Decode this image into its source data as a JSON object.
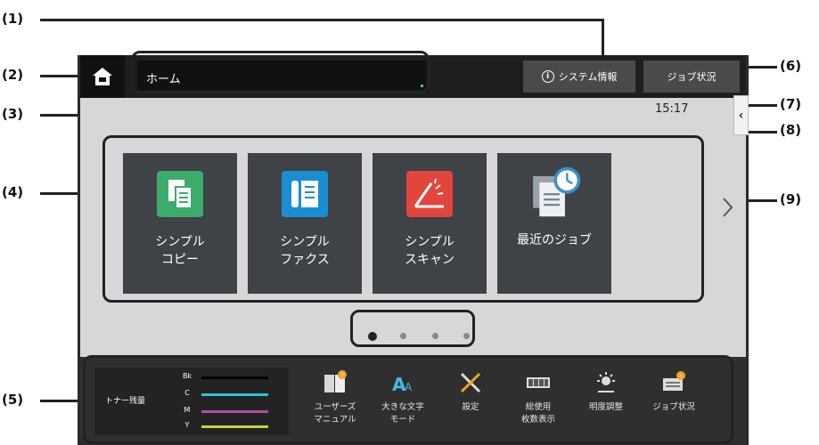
{
  "callouts": {
    "c1": "(1)",
    "c2": "(2)",
    "c3": "(3)",
    "c4": "(4)",
    "c5": "(5)",
    "c6": "(6)",
    "c7": "(7)",
    "c8": "(8)",
    "c9": "(9)"
  },
  "header": {
    "title": "ホーム",
    "system_info_label": "システム情報",
    "job_status_label": "ジョブ状況"
  },
  "clock": "15:17",
  "tiles": [
    {
      "line1": "シンプル",
      "line2": "コピー",
      "icon": "copy-icon",
      "color": "#3dab6e"
    },
    {
      "line1": "シンプル",
      "line2": "ファクス",
      "icon": "fax-icon",
      "color": "#1b8ed3"
    },
    {
      "line1": "シンプル",
      "line2": "スキャン",
      "icon": "scan-icon",
      "color": "#e2453c"
    },
    {
      "line1": "最近のジョブ",
      "line2": "",
      "icon": "recent-jobs-icon",
      "color": "#7fa6c9"
    }
  ],
  "page_dots": {
    "count": 4,
    "active": 1
  },
  "toner": {
    "label": "トナー残量",
    "channels": [
      {
        "name": "Bk",
        "color": "#000000"
      },
      {
        "name": "C",
        "color": "#28c6d6"
      },
      {
        "name": "M",
        "color": "#b04aa6"
      },
      {
        "name": "Y",
        "color": "#c9cf3a"
      }
    ]
  },
  "shortcuts": [
    {
      "line1": "ユーザーズ",
      "line2": "マニュアル",
      "icon": "manual-icon"
    },
    {
      "line1": "大きな文字",
      "line2": "モード",
      "icon": "large-text-icon"
    },
    {
      "line1": "設定",
      "line2": "",
      "icon": "settings-icon"
    },
    {
      "line1": "総使用",
      "line2": "枚数表示",
      "icon": "counter-icon"
    },
    {
      "line1": "明度調整",
      "line2": "",
      "icon": "brightness-icon"
    },
    {
      "line1": "ジョブ状況",
      "line2": "",
      "icon": "job-status-icon"
    }
  ]
}
